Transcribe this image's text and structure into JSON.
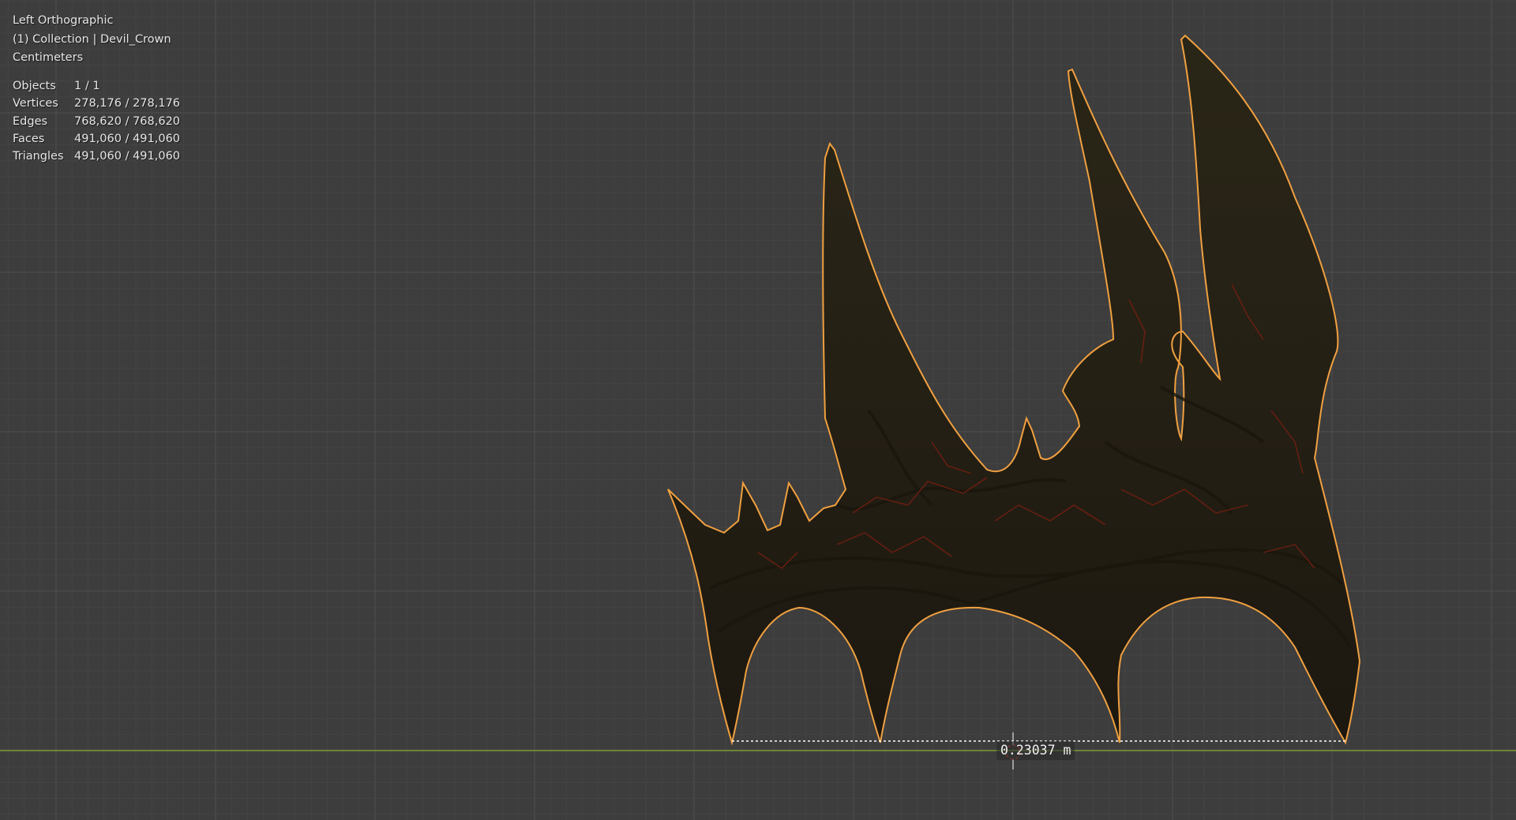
{
  "viewport": {
    "view_name": "Left Orthographic",
    "collection_line": "(1) Collection | Devil_Crown",
    "units": "Centimeters"
  },
  "stats": [
    {
      "label": "Objects",
      "value": "1 / 1"
    },
    {
      "label": "Vertices",
      "value": "278,176 / 278,176"
    },
    {
      "label": "Edges",
      "value": "768,620 / 768,620"
    },
    {
      "label": "Faces",
      "value": "491,060 / 491,060"
    },
    {
      "label": "Triangles",
      "value": "491,060 / 491,060"
    }
  ],
  "measure": {
    "value": "0.23037 m"
  },
  "colors": {
    "background": "#3d3d3d",
    "grid_minor": "#444444",
    "grid_major": "#4f4f4f",
    "ground_axis": "#7d9b3a",
    "selection_outline": "#f0a040",
    "model_fill": "#2b2618",
    "crack_red": "#7a1e10"
  }
}
